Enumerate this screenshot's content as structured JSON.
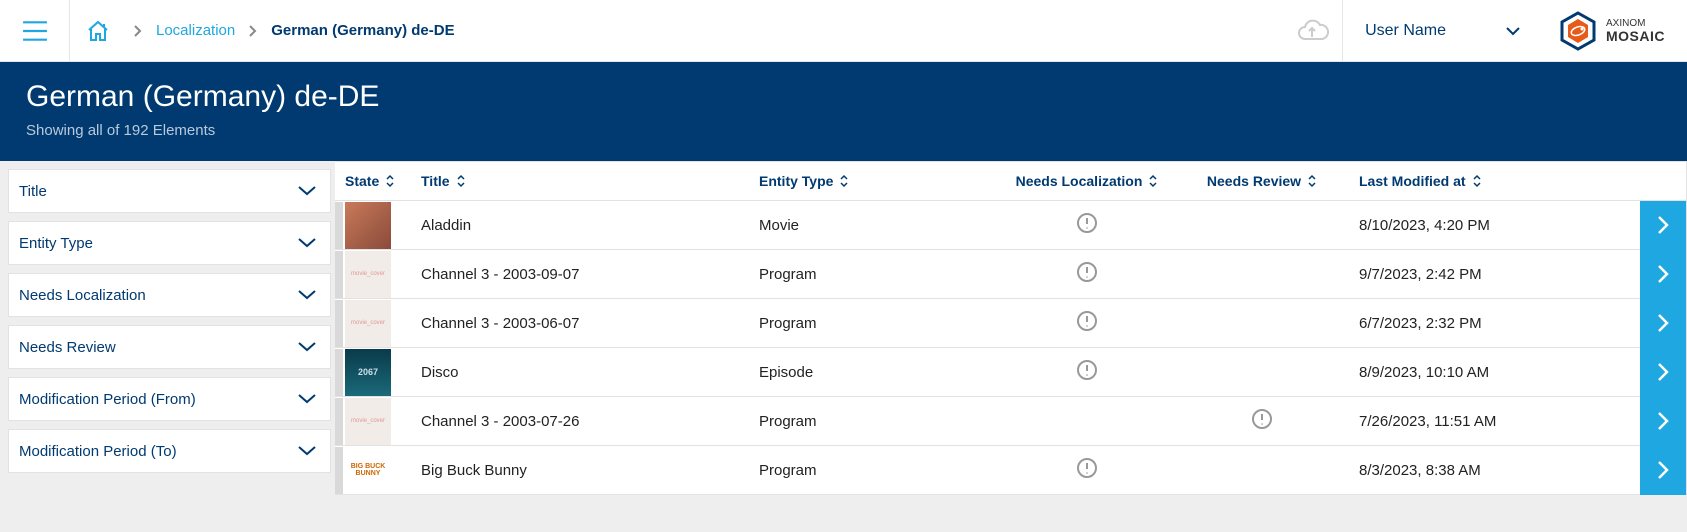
{
  "breadcrumb": {
    "localization": "Localization",
    "current": "German (Germany) de-DE"
  },
  "user": {
    "name": "User Name"
  },
  "brand": {
    "top": "AXINOM",
    "main": "MOSAIC"
  },
  "hero": {
    "title": "German (Germany) de-DE",
    "subtitle": "Showing all of 192 Elements"
  },
  "filters": {
    "title": "Title",
    "entity_type": "Entity Type",
    "needs_localization": "Needs Localization",
    "needs_review": "Needs Review",
    "mod_from": "Modification Period (From)",
    "mod_to": "Modification Period (To)"
  },
  "columns": {
    "state": "State",
    "title": "Title",
    "entity_type": "Entity Type",
    "needs_localization": "Needs Localization",
    "needs_review": "Needs Review",
    "last_modified": "Last Modified at"
  },
  "rows": [
    {
      "thumb_class": "aladdin",
      "thumb_text": "",
      "title": "Aladdin",
      "entity_type": "Movie",
      "needs_localization": true,
      "needs_review": false,
      "last_modified": "8/10/2023, 4:20 PM"
    },
    {
      "thumb_class": "plain",
      "thumb_text": "movie_cover",
      "title": "Channel 3 - 2003-09-07",
      "entity_type": "Program",
      "needs_localization": true,
      "needs_review": false,
      "last_modified": "9/7/2023, 2:42 PM"
    },
    {
      "thumb_class": "plain",
      "thumb_text": "movie_cover",
      "title": "Channel 3 - 2003-06-07",
      "entity_type": "Program",
      "needs_localization": true,
      "needs_review": false,
      "last_modified": "6/7/2023, 2:32 PM"
    },
    {
      "thumb_class": "disco",
      "thumb_text": "2067",
      "title": "Disco",
      "entity_type": "Episode",
      "needs_localization": true,
      "needs_review": false,
      "last_modified": "8/9/2023, 10:10 AM"
    },
    {
      "thumb_class": "plain",
      "thumb_text": "movie_cover",
      "title": "Channel 3 - 2003-07-26",
      "entity_type": "Program",
      "needs_localization": false,
      "needs_review": true,
      "last_modified": "7/26/2023, 11:51 AM"
    },
    {
      "thumb_class": "bunny",
      "thumb_text": "BIG BUCK BUNNY",
      "title": "Big Buck Bunny",
      "entity_type": "Program",
      "needs_localization": true,
      "needs_review": false,
      "last_modified": "8/3/2023, 8:38 AM"
    }
  ]
}
